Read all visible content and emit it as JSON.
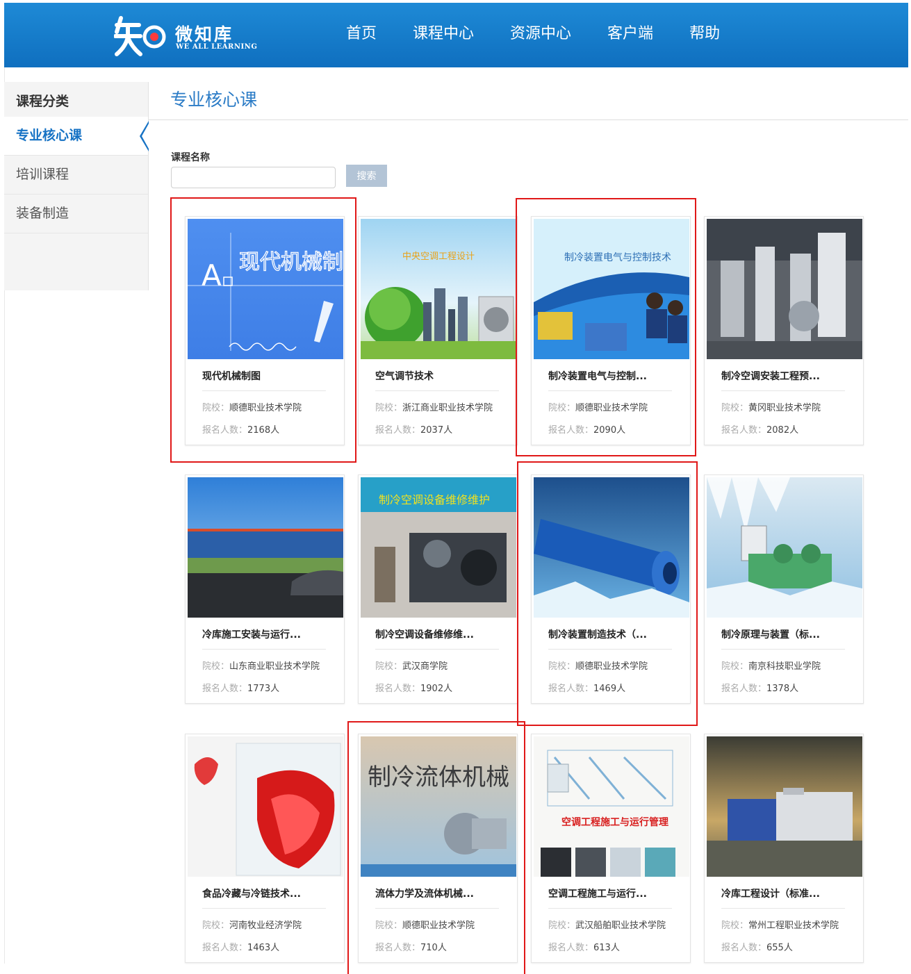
{
  "header": {
    "logo_cn": "微知库",
    "logo_en": "WE ALL LEARNING",
    "nav": [
      "首页",
      "课程中心",
      "资源中心",
      "客户端",
      "帮助"
    ]
  },
  "sidebar": {
    "title": "课程分类",
    "items": [
      {
        "label": "专业核心课",
        "active": true
      },
      {
        "label": "培训课程",
        "active": false
      },
      {
        "label": "装备制造",
        "active": false
      }
    ]
  },
  "main": {
    "title": "专业核心课",
    "search_label": "课程名称",
    "search_value": "",
    "search_button": "搜索"
  },
  "card_labels": {
    "school": "院校：",
    "count": "报名人数："
  },
  "courses": [
    {
      "title": "现代机械制图",
      "school": "顺德职业技术学院",
      "count": "2168人",
      "thumb_text": "现代机械制图"
    },
    {
      "title": "空气调节技术",
      "school": "浙江商业职业技术学院",
      "count": "2037人",
      "thumb_text": "中央空调工程设计"
    },
    {
      "title": "制冷装置电气与控制...",
      "school": "顺德职业技术学院",
      "count": "2090人",
      "thumb_text": "制冷装置电气与控制技术"
    },
    {
      "title": "制冷空调安装工程预...",
      "school": "黄冈职业技术学院",
      "count": "2082人",
      "thumb_text": ""
    },
    {
      "title": "冷库施工安装与运行...",
      "school": "山东商业职业技术学院",
      "count": "1773人",
      "thumb_text": ""
    },
    {
      "title": "制冷空调设备维修维...",
      "school": "武汉商学院",
      "count": "1902人",
      "thumb_text": "制冷空调设备维修维护"
    },
    {
      "title": "制冷装置制造技术（...",
      "school": "顺德职业技术学院",
      "count": "1469人",
      "thumb_text": ""
    },
    {
      "title": "制冷原理与装置（标...",
      "school": "南京科技职业学院",
      "count": "1378人",
      "thumb_text": ""
    },
    {
      "title": "食品冷藏与冷链技术...",
      "school": "河南牧业经济学院",
      "count": "1463人",
      "thumb_text": ""
    },
    {
      "title": "流体力学及流体机械...",
      "school": "顺德职业技术学院",
      "count": "710人",
      "thumb_text": "制冷流体机械"
    },
    {
      "title": "空调工程施工与运行...",
      "school": "武汉船舶职业技术学院",
      "count": "613人",
      "thumb_text": "空调工程施工与运行管理"
    },
    {
      "title": "冷库工程设计（标准...",
      "school": "常州工程职业技术学院",
      "count": "655人",
      "thumb_text": ""
    }
  ],
  "colors": {
    "header": "#1577c9",
    "accent": "#1672c4",
    "highlight": "#e01818"
  }
}
